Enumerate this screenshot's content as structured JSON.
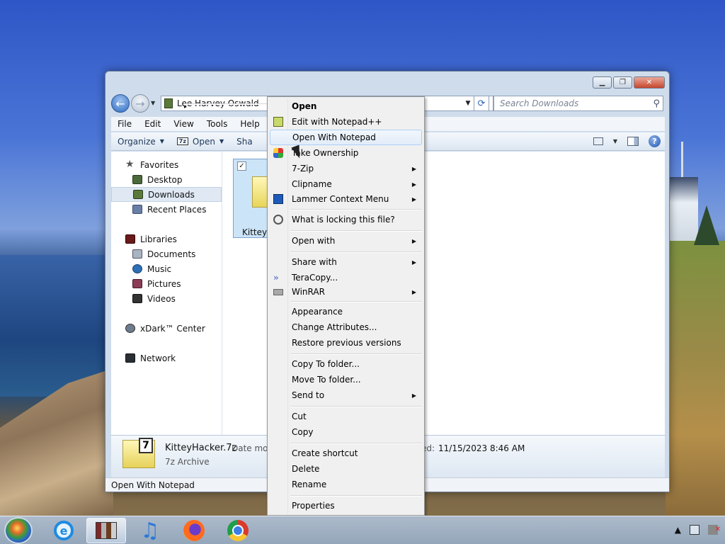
{
  "window": {
    "controls": {
      "minimize": "▁",
      "maximize": "❐",
      "close": "✕"
    }
  },
  "address": {
    "path": "Lee Harvey Oswald",
    "separator": "▸"
  },
  "search": {
    "placeholder": "Search Downloads"
  },
  "menubar": [
    "File",
    "Edit",
    "View",
    "Tools",
    "Help"
  ],
  "toolbar": {
    "organize": "Organize",
    "open": "Open",
    "share_partial": "Sha"
  },
  "navpane": {
    "favorites": "Favorites",
    "favorites_items": [
      "Desktop",
      "Downloads",
      "Recent Places"
    ],
    "libraries": "Libraries",
    "libraries_items": [
      "Documents",
      "Music",
      "Pictures",
      "Videos"
    ],
    "xdark": "xDark™ Center",
    "network": "Network"
  },
  "file": {
    "name_partial": "KitteyH",
    "checkbox": "✓"
  },
  "details": {
    "name": "KitteyHacker.7z",
    "date_label": "Date mod",
    "type": "7z Archive",
    "modified_label": "ed:",
    "modified_value": "11/15/2023 8:46 AM",
    "tag": "7"
  },
  "statusbar": {
    "text": "Open With Notepad"
  },
  "context_menu": {
    "open": "Open",
    "edit_npp": "Edit with Notepad++",
    "open_notepad": "Open With Notepad",
    "take_ownership": "Take Ownership",
    "seven_zip": "7-Zip",
    "clipname": "Clipname",
    "lammer": "Lammer Context Menu",
    "locking": "What is locking this file?",
    "open_with": "Open with",
    "share_with": "Share with",
    "teracopy": "TeraCopy...",
    "winrar": "WinRAR",
    "appearance": "Appearance",
    "change_attr": "Change Attributes...",
    "restore": "Restore previous versions",
    "copy_to": "Copy To folder...",
    "move_to": "Move To folder...",
    "send_to": "Send to",
    "cut": "Cut",
    "copy": "Copy",
    "create_shortcut": "Create shortcut",
    "delete": "Delete",
    "rename": "Rename",
    "properties": "Properties",
    "submenu_arrow": "▶"
  },
  "taskbar": {
    "ie_label": "e",
    "tray_arrow": "▲"
  },
  "colors": {
    "menu_hover": "#e1ecf9",
    "window_frame": "#cfdcec",
    "accent": "#2e6bc2"
  }
}
